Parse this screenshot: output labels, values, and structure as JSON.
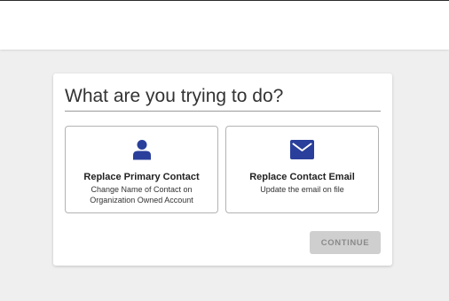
{
  "dialog": {
    "title": "What are you trying to do?",
    "options": [
      {
        "title": "Replace Primary Contact",
        "description": "Change Name of Contact on Organization Owned Account",
        "icon": "person-icon"
      },
      {
        "title": "Replace Contact Email",
        "description": "Update the email on file",
        "icon": "envelope-icon"
      }
    ],
    "continue_label": "CONTINUE",
    "continue_disabled": true
  },
  "colors": {
    "accent": "#2a3f9b",
    "background": "#efefef",
    "button_disabled_bg": "#cfcfcf",
    "button_disabled_text": "#8a8a8a"
  }
}
